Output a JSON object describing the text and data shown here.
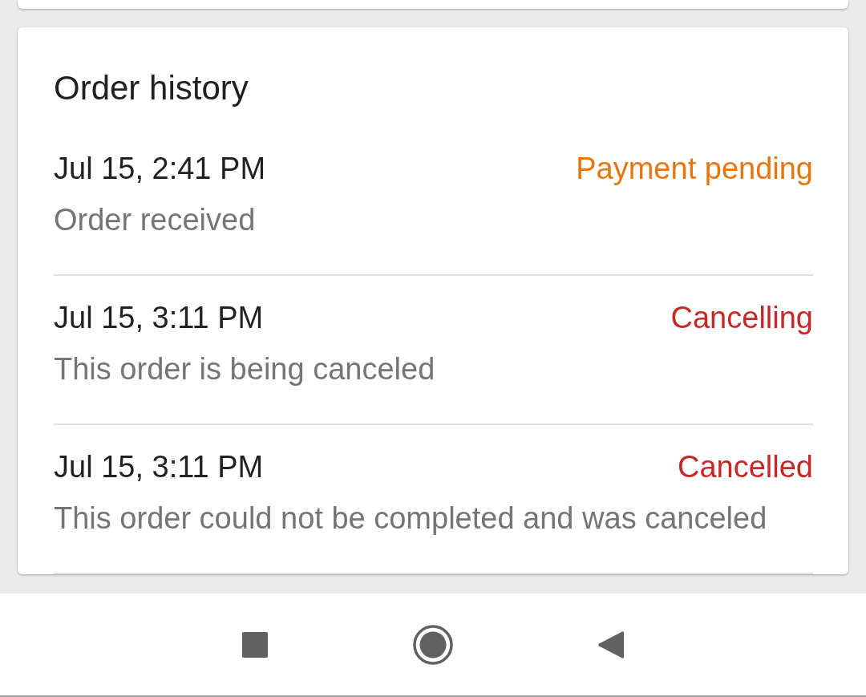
{
  "order_history": {
    "title": "Order history",
    "entries": [
      {
        "time": "Jul 15, 2:41 PM",
        "status": "Payment pending",
        "color": "#e67710",
        "description": "Order received"
      },
      {
        "time": "Jul 15, 3:11 PM",
        "status": "Cancelling",
        "color": "#c62828",
        "description": "This order is being canceled"
      },
      {
        "time": "Jul 15, 3:11 PM",
        "status": "Cancelled",
        "color": "#c62828",
        "description": "This order could not be completed and was canceled"
      }
    ]
  },
  "nav_bar": {
    "buttons": [
      {
        "kind": "recents"
      },
      {
        "kind": "home"
      },
      {
        "kind": "back"
      }
    ]
  }
}
